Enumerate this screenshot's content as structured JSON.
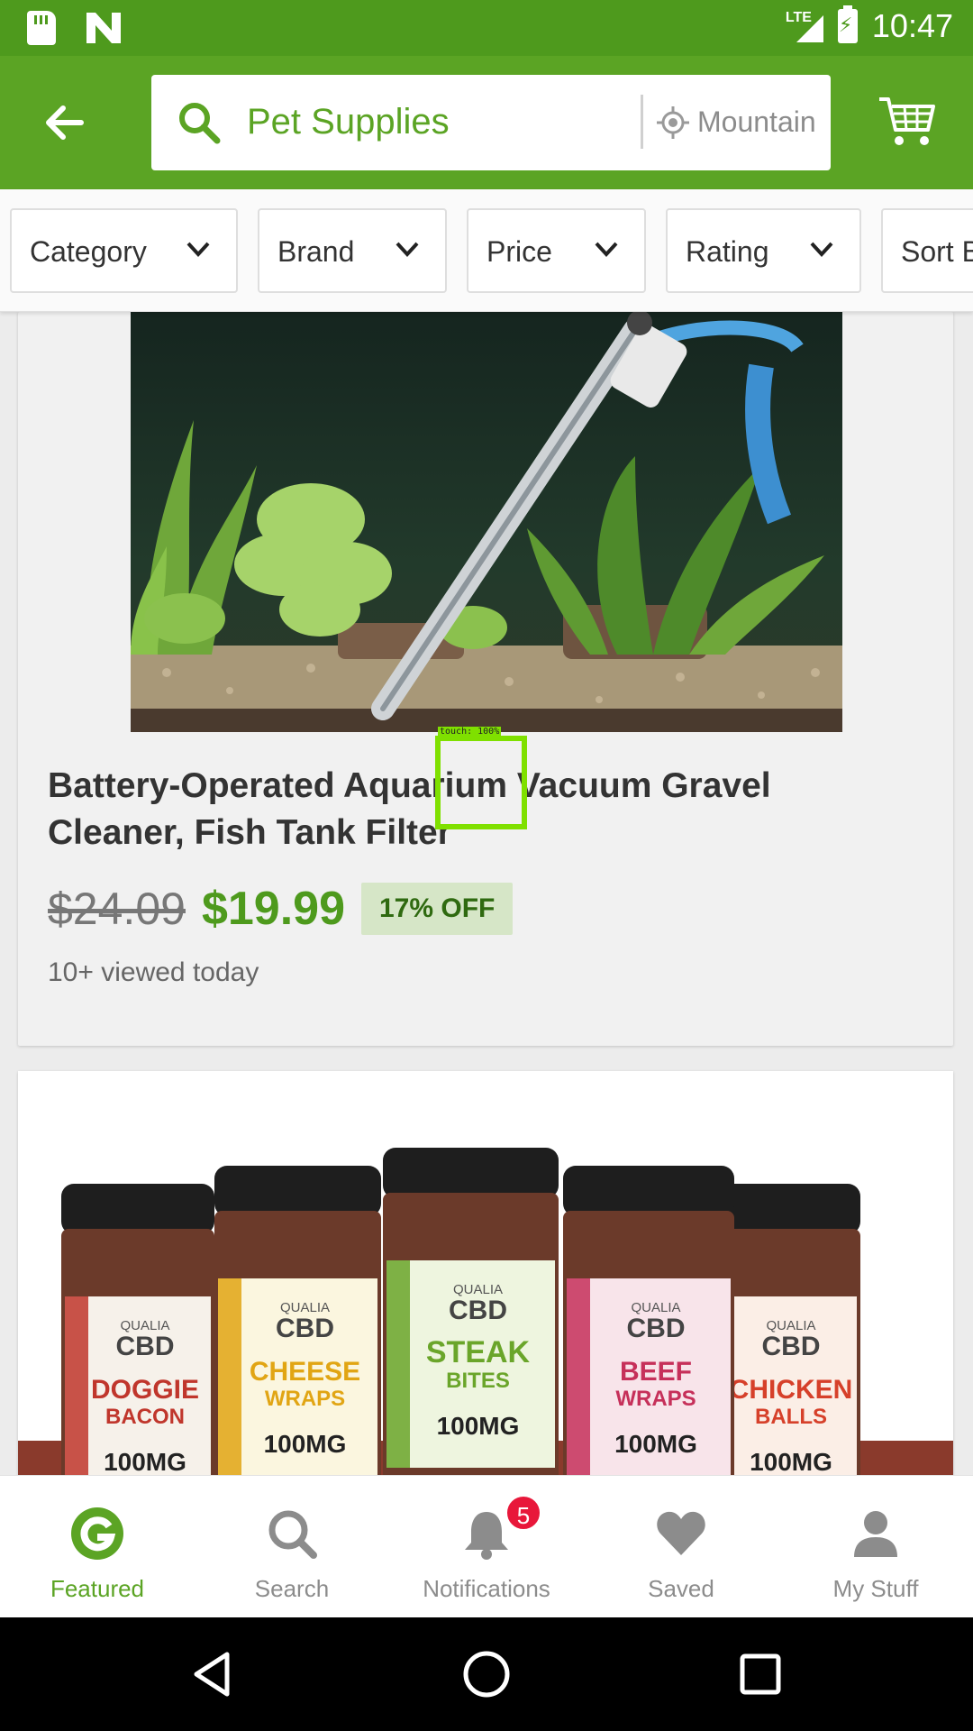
{
  "status_bar": {
    "network": "LTE",
    "time": "10:47"
  },
  "app_bar": {
    "search_query": "Pet Supplies",
    "location": "Mountain"
  },
  "filters": [
    {
      "label": "Category"
    },
    {
      "label": "Brand"
    },
    {
      "label": "Price"
    },
    {
      "label": "Rating"
    },
    {
      "label": "Sort B"
    }
  ],
  "products": [
    {
      "title": "Battery-Operated Aquarium Vacuum Gravel Cleaner, Fish Tank Filter",
      "old_price": "$24.09",
      "price": "$19.99",
      "discount": "17% OFF",
      "views": "10+ viewed today"
    },
    {
      "jars": [
        {
          "brand": "QUALIA",
          "brand2": "CBD",
          "name1": "DOGGIE",
          "name2": "BACON",
          "dose": "100MG",
          "color": "#c0362c",
          "label_color": "#f6f1ea"
        },
        {
          "brand": "QUALIA",
          "brand2": "CBD",
          "name1": "CHEESE",
          "name2": "WRAPS",
          "dose": "100MG",
          "color": "#e1a514",
          "label_color": "#fbf6df"
        },
        {
          "brand": "QUALIA",
          "brand2": "CBD",
          "name1": "STEAK",
          "name2": "BITES",
          "dose": "100MG",
          "color": "#6aa52a",
          "label_color": "#eef5df"
        },
        {
          "brand": "QUALIA",
          "brand2": "CBD",
          "name1": "BEEF",
          "name2": "WRAPS",
          "dose": "100MG",
          "color": "#c6305a",
          "label_color": "#f8e4ea"
        },
        {
          "brand": "QUALIA",
          "brand2": "CBD",
          "name1": "CHICKEN",
          "name2": "BALLS",
          "dose": "100MG",
          "color": "#d6402a",
          "label_color": "#fbeee6"
        }
      ]
    }
  ],
  "touch_overlay": "touch: 100%",
  "bottom_nav": {
    "items": [
      {
        "label": "Featured",
        "icon": "g-logo-icon"
      },
      {
        "label": "Search",
        "icon": "search-icon"
      },
      {
        "label": "Notifications",
        "icon": "bell-icon",
        "badge": "5"
      },
      {
        "label": "Saved",
        "icon": "heart-icon"
      },
      {
        "label": "My Stuff",
        "icon": "person-icon"
      }
    ]
  },
  "colors": {
    "brand_green": "#5ba424",
    "status_green": "#4e9a1d",
    "badge_red": "#e8173a"
  }
}
